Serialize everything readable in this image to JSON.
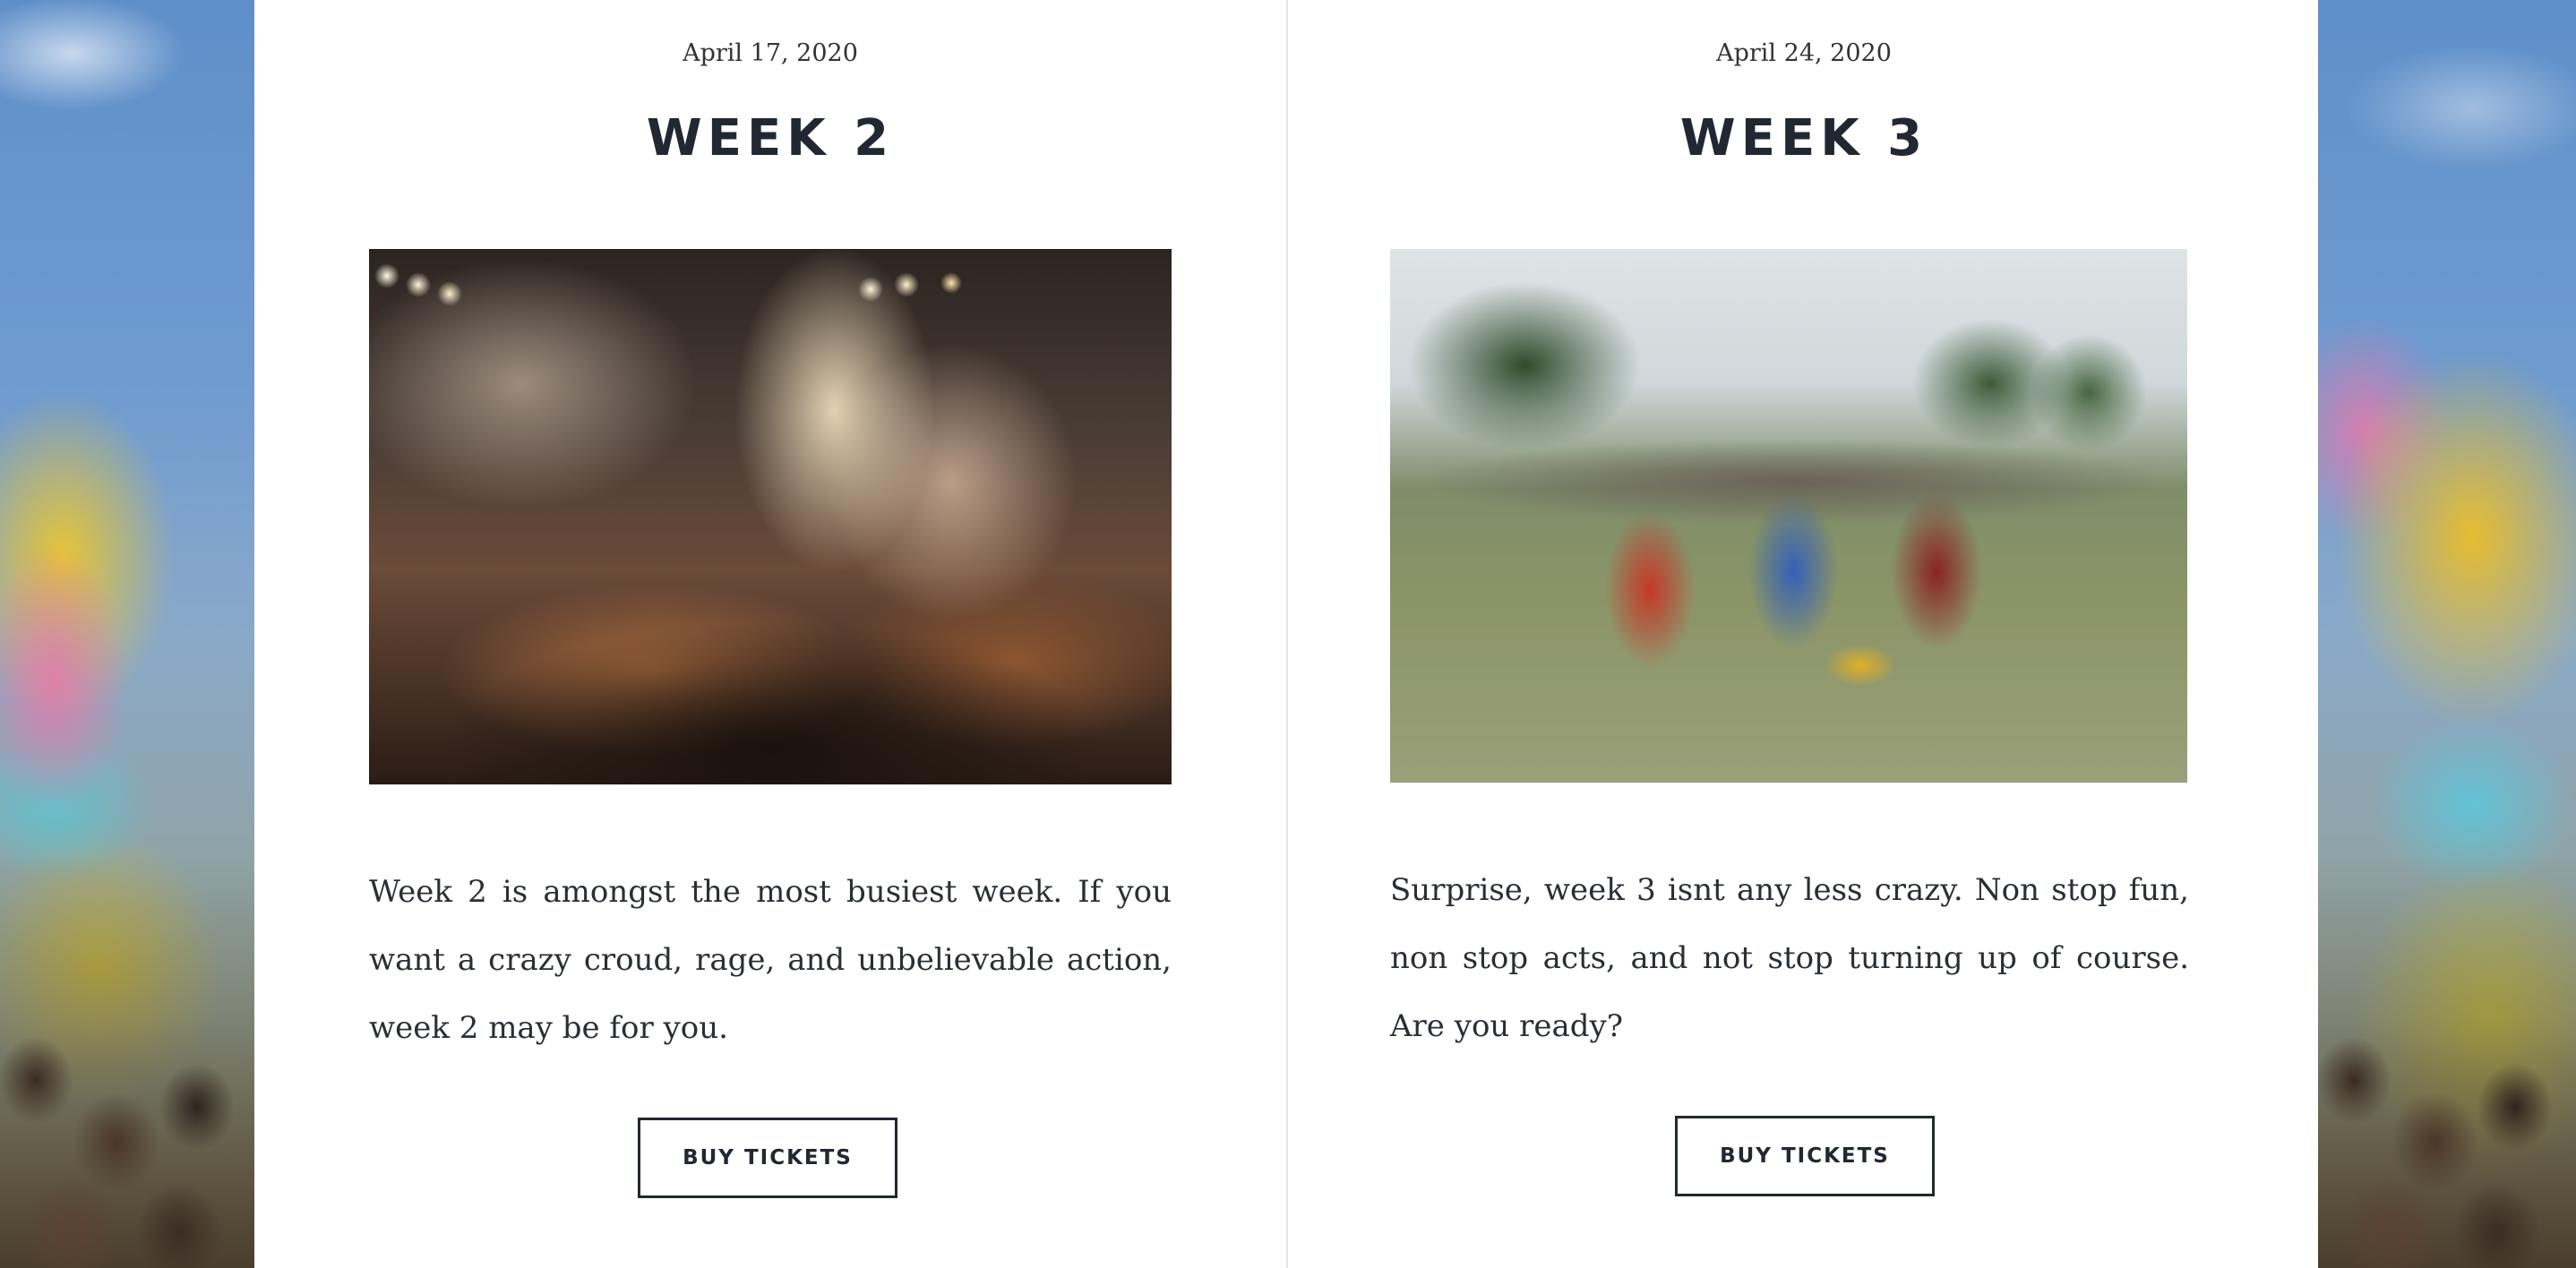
{
  "events": [
    {
      "date": "April 17, 2020",
      "title": "WEEK 2",
      "description": "Week 2 is amongst the most busiest week. If you want a crazy croud, rage, and unbelievable action, week 2 may be for you.",
      "button_label": "BUY TICKETS"
    },
    {
      "date": "April 24, 2020",
      "title": "WEEK 3",
      "description": "Surprise, week 3 isnt any less crazy. Non stop fun, non stop acts, and not stop turning up of course. Are you ready?",
      "button_label": "BUY TICKETS"
    }
  ]
}
